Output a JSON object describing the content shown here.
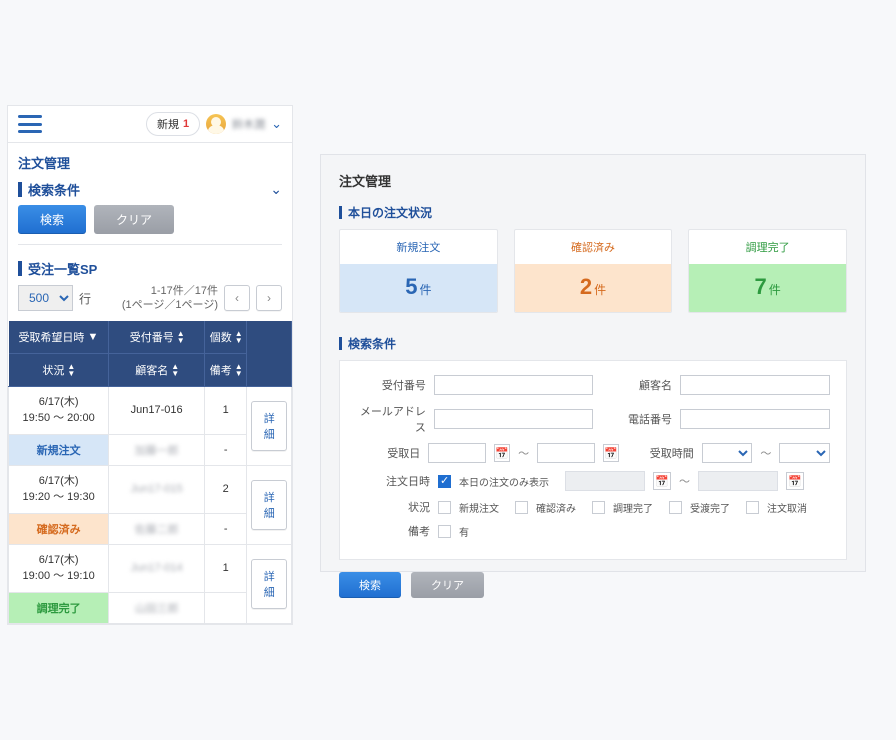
{
  "mobile": {
    "header": {
      "new_label": "新規",
      "new_count": "1",
      "username": "鈴木潤"
    },
    "page_title": "注文管理",
    "search_section": "検索条件",
    "btn_search": "検索",
    "btn_clear": "クリア",
    "list_section": "受注一覧SP",
    "rows_value": "500",
    "rows_suffix": "行",
    "pagination_line1": "1-17件／17件",
    "pagination_line2": "(1ページ／1ページ)",
    "columns": {
      "pickup": "受取希望日時",
      "order_no": "受付番号",
      "qty": "個数",
      "status": "状況",
      "customer": "顧客名",
      "memo": "備考"
    },
    "detail_label": "詳細",
    "rows": [
      {
        "date": "6/17(木)",
        "time": "19:50 〜 20:00",
        "order_no": "Jun17-016",
        "qty": "1",
        "status_label": "新規注文",
        "status_class": "status-new",
        "customer": "加藤一郎",
        "memo": "-"
      },
      {
        "date": "6/17(木)",
        "time": "19:20 〜 19:30",
        "order_no": "Jun17-015",
        "qty": "2",
        "status_label": "確認済み",
        "status_class": "status-confirmed",
        "customer": "佐藤二郎",
        "memo": "-"
      },
      {
        "date": "6/17(木)",
        "time": "19:00 〜 19:10",
        "order_no": "Jun17-014",
        "qty": "1",
        "status_label": "調理完了",
        "status_class": "status-done",
        "customer": "山田三郎",
        "memo": ""
      }
    ]
  },
  "desktop": {
    "page_title": "注文管理",
    "today_section": "本日の注文状況",
    "cards": {
      "new_label": "新規注文",
      "new_count": "5",
      "new_unit": "件",
      "conf_label": "確認済み",
      "conf_count": "2",
      "conf_unit": "件",
      "done_label": "調理完了",
      "done_count": "7",
      "done_unit": "件"
    },
    "search_section": "検索条件",
    "labels": {
      "order_no": "受付番号",
      "customer": "顧客名",
      "email": "メールアドレス",
      "phone": "電話番号",
      "pickup_date": "受取日",
      "pickup_time": "受取時間",
      "order_datetime": "注文日時",
      "today_only": "本日の注文のみ表示",
      "status": "状況",
      "memo": "備考"
    },
    "status_opts": {
      "new": "新規注文",
      "confirmed": "確認済み",
      "cooked": "調理完了",
      "delivered": "受渡完了",
      "cancelled": "注文取消"
    },
    "memo_opt": "有",
    "btn_search": "検索",
    "btn_clear": "クリア",
    "tilde": "〜"
  }
}
